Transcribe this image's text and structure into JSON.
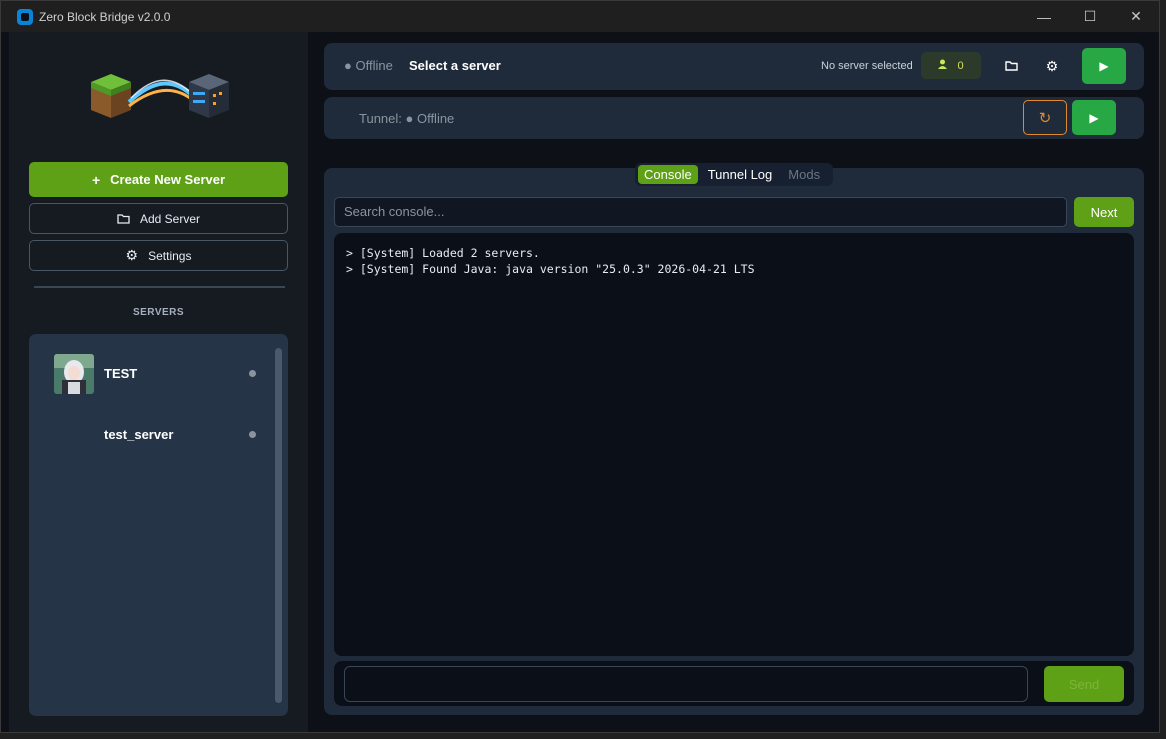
{
  "window": {
    "title": "Zero Block Bridge v2.0.0",
    "controls": [
      "—",
      "☐",
      "✕"
    ]
  },
  "sidebar": {
    "create_label": "Create New Server",
    "add_label": "Add Server",
    "settings_label": "Settings",
    "servers_heading": "SERVERS",
    "servers": [
      {
        "name": "TEST",
        "status": "offline",
        "has_avatar": true
      },
      {
        "name": "test_server",
        "status": "offline",
        "has_avatar": false
      }
    ]
  },
  "header": {
    "status": "● Offline",
    "title": "Select a server",
    "no_server_text": "No server selected",
    "player_count": "0",
    "tunnel_status": "Tunnel: ● Offline"
  },
  "console": {
    "tabs": [
      {
        "label": "Console",
        "active": true
      },
      {
        "label": "Tunnel Log",
        "active": false
      },
      {
        "label": "Mods",
        "active": false,
        "disabled": true
      }
    ],
    "search_placeholder": "Search console...",
    "next_label": "Next",
    "lines": [
      "> [System] Loaded 2 servers.",
      "> [System] Found Java: java version \"25.0.3\" 2026-04-21 LTS"
    ],
    "command_value": "",
    "send_label": "Send"
  },
  "colors": {
    "accent_green": "#5ea116",
    "play_green": "#28a745",
    "restart_orange": "#e08a2b",
    "panel": "#1f2b3b",
    "background": "#0d1117"
  }
}
